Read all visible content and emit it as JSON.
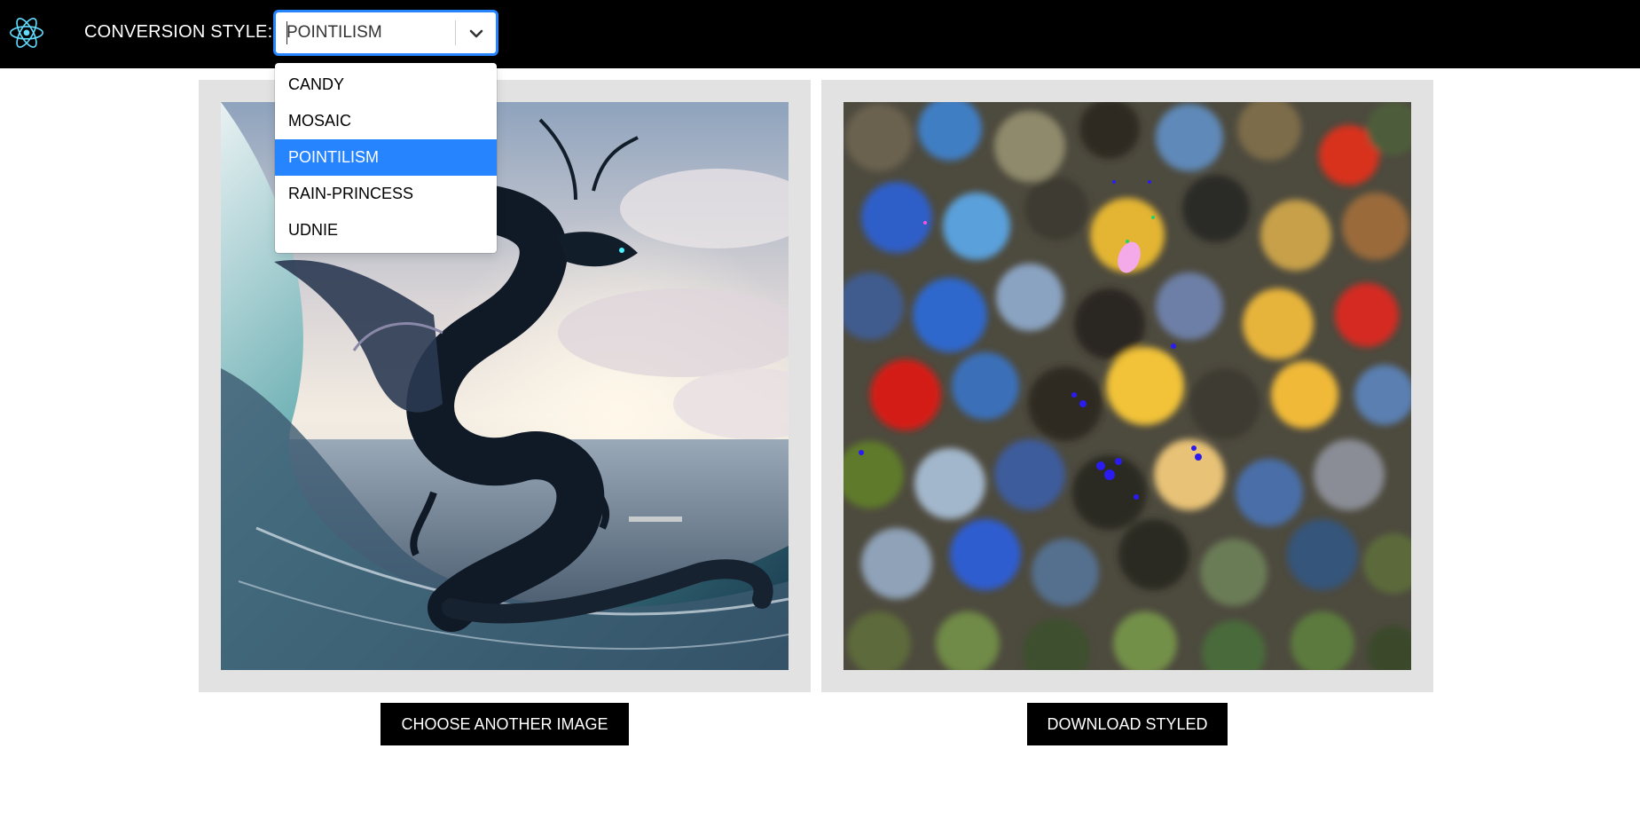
{
  "header": {
    "conversion_label": "CONVERSION STYLE:",
    "logo_icon": "react-atom-icon",
    "select": {
      "selected_value": "POINTILISM",
      "chevron_icon": "chevron-down-icon"
    }
  },
  "dropdown": {
    "options": [
      {
        "label": "CANDY",
        "selected": false
      },
      {
        "label": "MOSAIC",
        "selected": false
      },
      {
        "label": "POINTILISM",
        "selected": true
      },
      {
        "label": "RAIN-PRINCESS",
        "selected": false
      },
      {
        "label": "UDNIE",
        "selected": false
      }
    ]
  },
  "panels": {
    "original_image": "dragon-over-ocean-wave",
    "styled_image": "pointillism-styled-dragon"
  },
  "actions": {
    "choose_label": "CHOOSE ANOTHER IMAGE",
    "download_label": "DOWNLOAD STYLED"
  },
  "colors": {
    "topbar": "#000000",
    "accent": "#2684ff",
    "panel_bg": "#e2e2e2",
    "react_cyan": "#61dafb"
  }
}
